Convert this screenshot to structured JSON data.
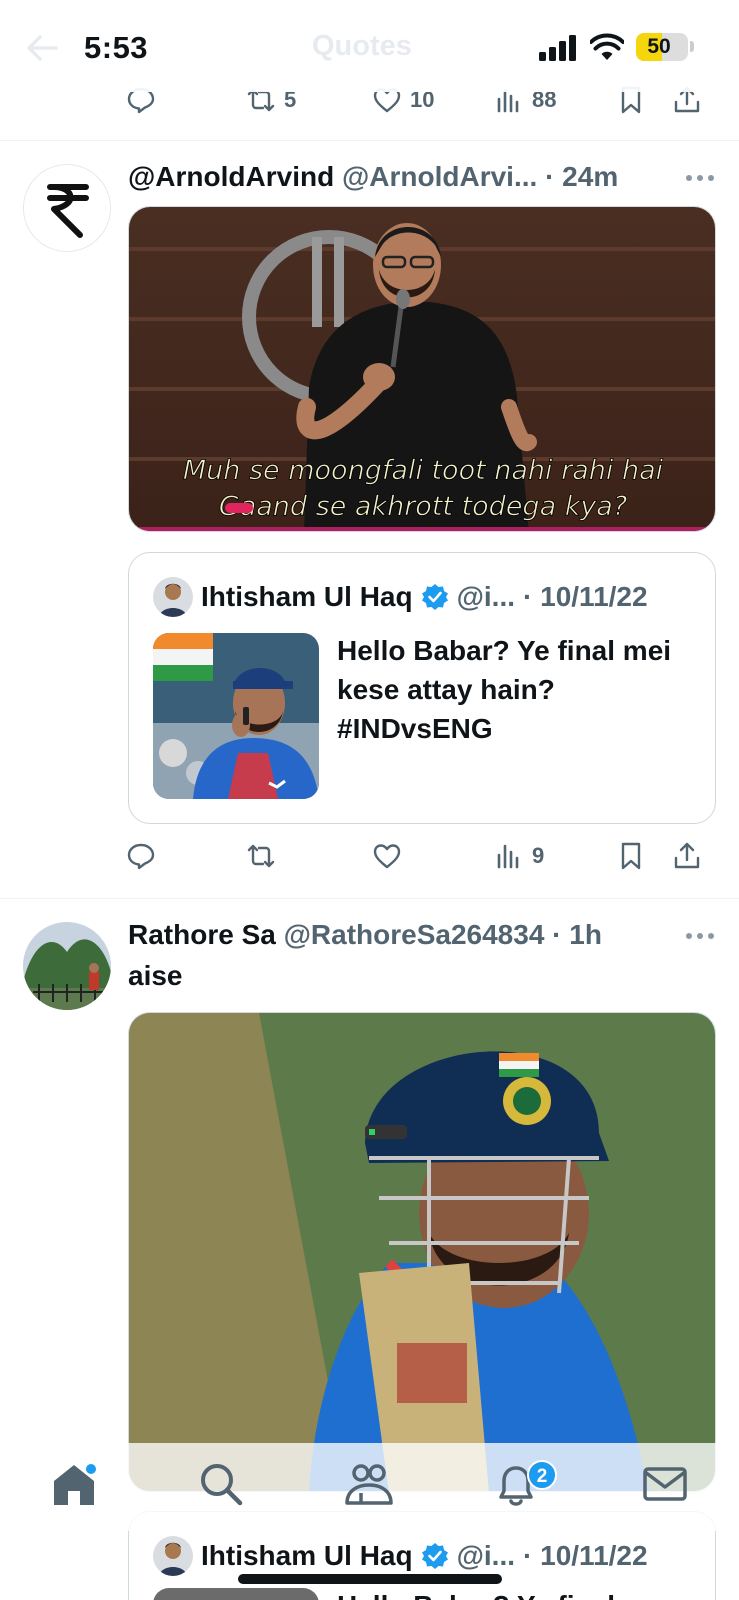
{
  "status_bar": {
    "time": "5:53",
    "battery": "50",
    "battery_level": 0.5
  },
  "header": {
    "title": "Quotes"
  },
  "top_actions": {
    "reply": "",
    "retweet": "5",
    "like": "10",
    "views": "88"
  },
  "tweet1": {
    "name": "@ArnoldArvind",
    "handle": "@ArnoldArvi...",
    "time": "· 24m",
    "image_caption_line1": "Muh se moongfali toot nahi rahi hai",
    "image_caption_line2": "Gaand se akhrott todega kya?",
    "quote": {
      "name": "Ihtisham Ul Haq",
      "handle": "@i...",
      "time": "· 10/11/22",
      "text": "Hello Babar? Ye final mei kese attay hain? #INDvsENG"
    },
    "actions": {
      "views": "9"
    }
  },
  "tweet2": {
    "name": "Rathore Sa",
    "handle": "@RathoreSa264834",
    "time": "· 1h",
    "text": "aise",
    "quote": {
      "name": "Ihtisham Ul Haq",
      "handle": "@i...",
      "time": "· 10/11/22",
      "text": "Hello Babar? Ye final"
    }
  },
  "tabbar": {
    "notifications_badge": "2"
  },
  "icons": {
    "back": "back-arrow-icon",
    "reply": "reply-icon",
    "retweet": "retweet-icon",
    "like": "heart-icon",
    "views": "views-icon",
    "bookmark": "bookmark-icon",
    "share": "share-icon",
    "more": "more-icon",
    "home": "home-icon",
    "search": "search-icon",
    "communities": "communities-icon",
    "notifications": "bell-icon",
    "messages": "mail-icon",
    "verified": "verified-badge-icon"
  },
  "colors": {
    "accent": "#1d9bf0",
    "secondary_text": "#536471",
    "battery": "#f5d60c"
  }
}
